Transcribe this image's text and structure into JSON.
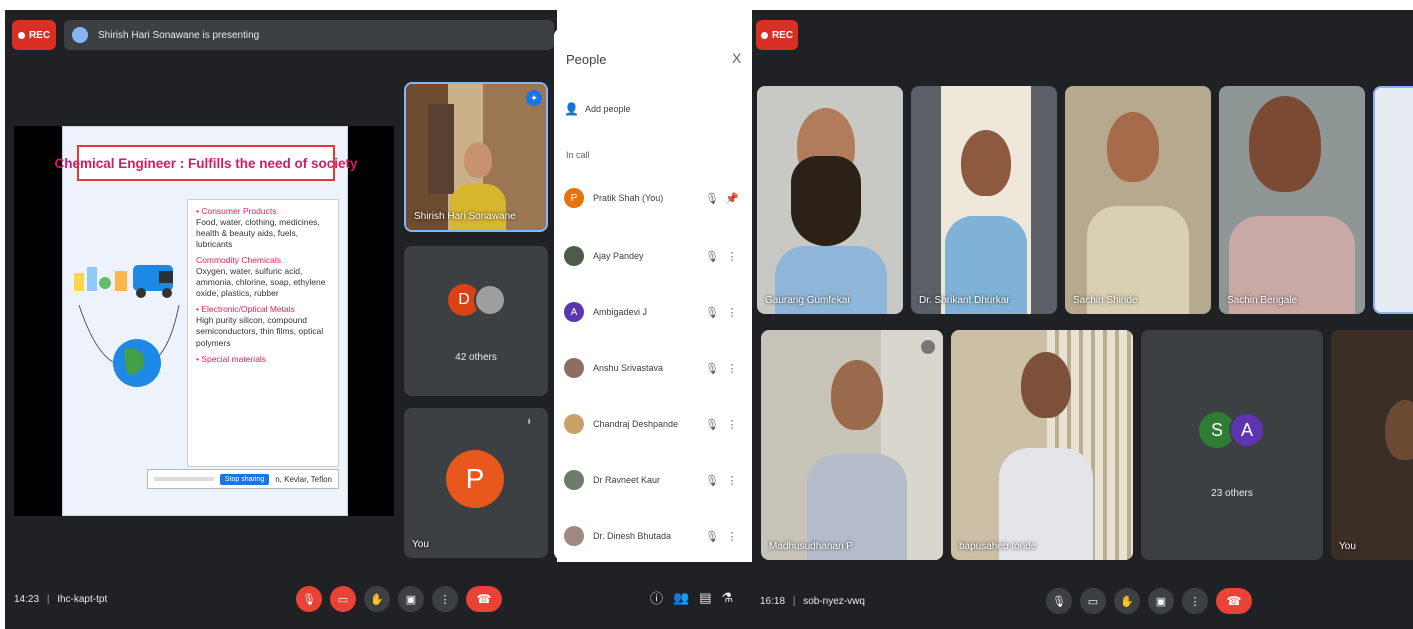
{
  "left_meeting": {
    "rec_label": "REC",
    "presenting_text": "Shirish Hari Sonawane is presenting",
    "slide": {
      "title": "Chemical Engineer : Fulfills the need of society",
      "sections": [
        {
          "heading": "• Consumer Products",
          "text": "Food, water, clothing, medicines, health & beauty aids, fuels, lubricants"
        },
        {
          "heading": "Commodity Chemicals",
          "text": "Oxygen, water, sulfuric acid, ammonia, chlorine, soap, ethylene oxide, plastics, rubber"
        },
        {
          "heading": "• Electronic/Optical Metals",
          "text": "High purity silicon, compound semiconductors, thin films, optical polymers"
        },
        {
          "heading": "• Special materials",
          "text": "n, Kevlar, Teflon"
        }
      ],
      "share_prompt_button": "Stop sharing"
    },
    "tiles": {
      "presenter_name": "Shirish Hari Sonawane",
      "others_label": "42 others",
      "avatar_initial": "D",
      "you_label": "You",
      "you_initial": "P"
    },
    "controls": {
      "time": "14:23",
      "meeting_code": "Ihc-kapt-tpt"
    }
  },
  "people_panel": {
    "title": "People",
    "close_glyph": "X",
    "add_people": "Add people",
    "in_call": "In call",
    "people": [
      {
        "name": "Pratik Shah (You)",
        "initial": "P",
        "color": "#e8710a"
      },
      {
        "name": "Ajay Pandey",
        "initial": "",
        "color": "#4e5b4a"
      },
      {
        "name": "Ambigadevi J",
        "initial": "A",
        "color": "#5e35b1"
      },
      {
        "name": "Anshu Srivastava",
        "initial": "",
        "color": "#8d6e63"
      },
      {
        "name": "Chandraj Deshpande",
        "initial": "",
        "color": "#c9a26b"
      },
      {
        "name": "Dr Ravneet Kaur",
        "initial": "",
        "color": "#6d7b6a"
      },
      {
        "name": "Dr. Dinesh Bhutada",
        "initial": "",
        "color": "#a1887f"
      }
    ]
  },
  "right_meeting": {
    "rec_label": "REC",
    "participants_row1": [
      "Gaurang Gumfekar",
      "Dr. Shrikant Dhurkar",
      "Sachin Shinde",
      "Sachin Bengale"
    ],
    "participants_row2": [
      "Madhusudhanan P",
      "bapusaheb tonde"
    ],
    "others_label": "23 others",
    "avatar_initials": [
      "S",
      "A"
    ],
    "you_label": "You",
    "controls": {
      "time": "16:18",
      "meeting_code": "sob-nyez-vwq"
    }
  }
}
